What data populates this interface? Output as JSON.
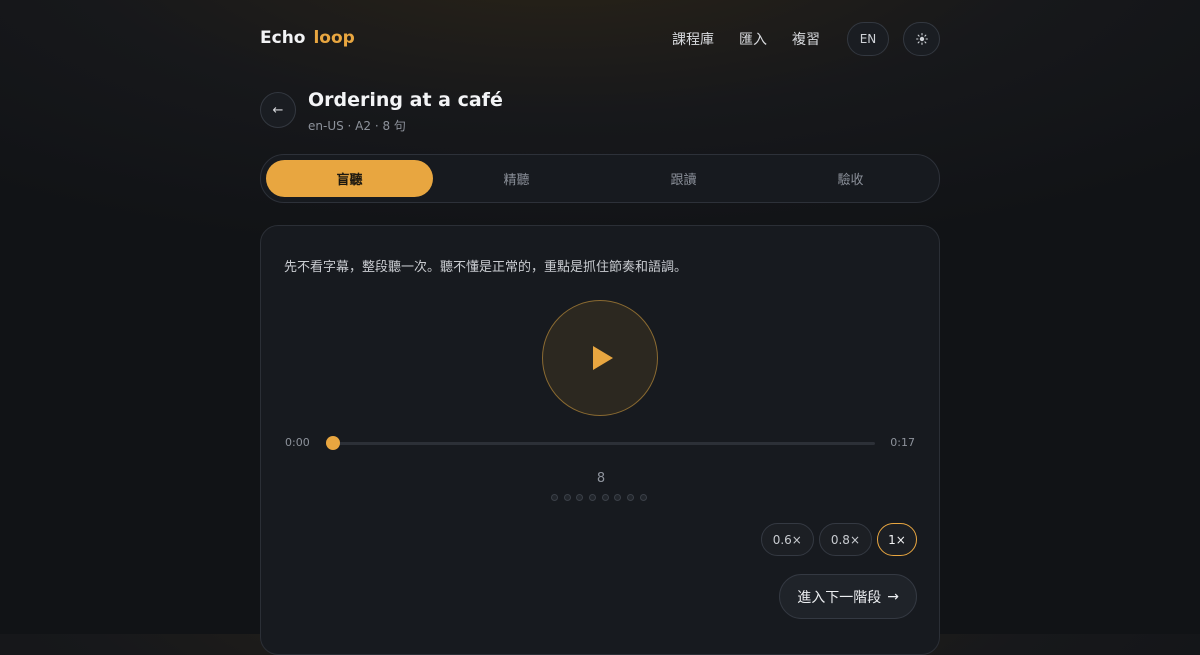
{
  "header": {
    "brand_part1": "Echo",
    "brand_part2": "loop",
    "nav": [
      "課程庫",
      "匯入",
      "複習"
    ],
    "lang_label": "EN",
    "theme_icon": "sun-icon"
  },
  "lesson": {
    "title": "Ordering at a café",
    "meta": "en-US · A2 · 8 句"
  },
  "tabs": [
    {
      "label": "盲聽",
      "active": true
    },
    {
      "label": "精聽",
      "active": false
    },
    {
      "label": "跟讀",
      "active": false
    },
    {
      "label": "驗收",
      "active": false
    }
  ],
  "player": {
    "instruction": "先不看字幕，整段聽一次。聽不懂是正常的，重點是抓住節奏和語調。",
    "current_time": "0:00",
    "total_time": "0:17",
    "progress": 0,
    "sentence_count": "8",
    "speeds": [
      "0.6×",
      "0.8×",
      "1×"
    ],
    "selected_speed": "1×",
    "next_label": "進入下一階段",
    "next_arrow": "→"
  },
  "colors": {
    "accent": "#e8a640",
    "background": "#17181b",
    "card": "#171a1f"
  }
}
